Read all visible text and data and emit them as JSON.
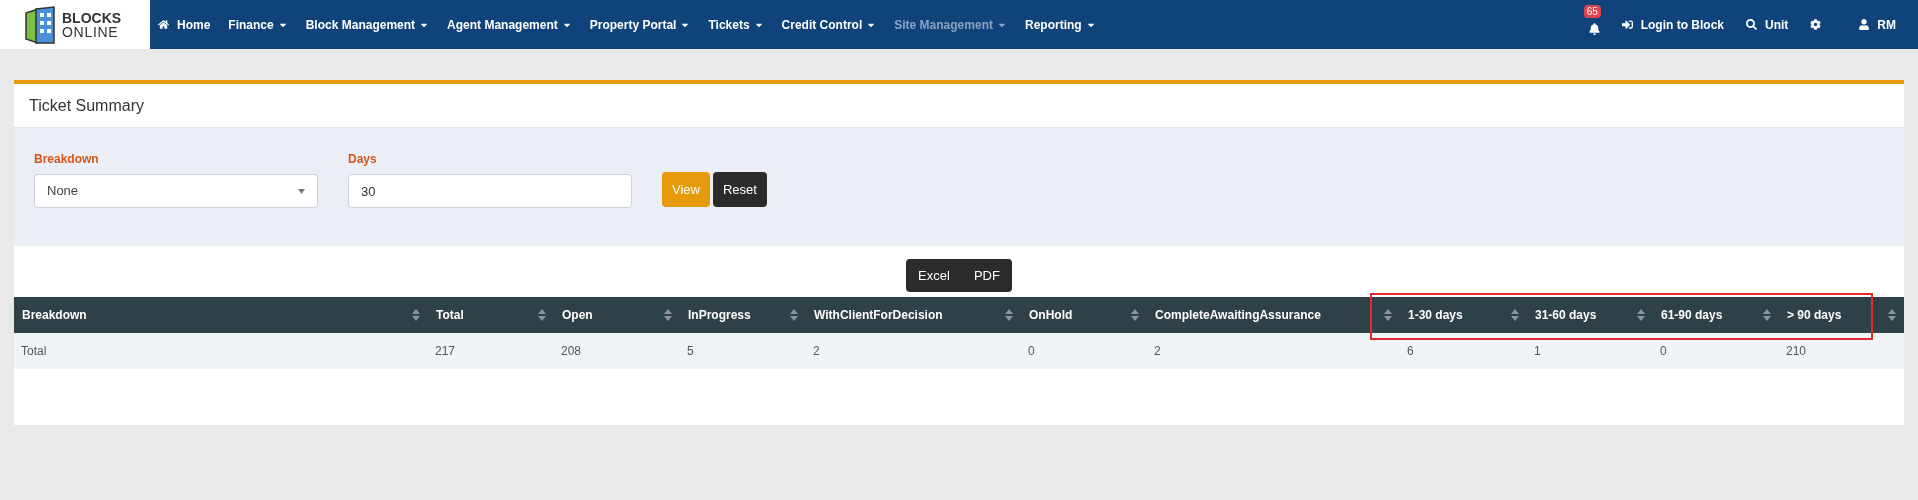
{
  "logo": {
    "line1": "BLOCKS",
    "line2": "ONLINE"
  },
  "nav": [
    {
      "label": "Home",
      "kind": "home",
      "dropdown": false,
      "disabled": false
    },
    {
      "label": "Finance",
      "dropdown": true,
      "disabled": false
    },
    {
      "label": "Block Management",
      "dropdown": true,
      "disabled": false
    },
    {
      "label": "Agent Management",
      "dropdown": true,
      "disabled": false
    },
    {
      "label": "Property Portal",
      "dropdown": true,
      "disabled": false
    },
    {
      "label": "Tickets",
      "dropdown": true,
      "disabled": false
    },
    {
      "label": "Credit Control",
      "dropdown": true,
      "disabled": false
    },
    {
      "label": "Site Management",
      "dropdown": true,
      "disabled": true
    },
    {
      "label": "Reporting",
      "dropdown": true,
      "disabled": false
    }
  ],
  "nav_right": {
    "notifications": {
      "count": "65"
    },
    "login": "Login to Block",
    "search": "Unit",
    "user": "RM"
  },
  "panel": {
    "title": "Ticket Summary"
  },
  "filters": {
    "breakdown": {
      "label": "Breakdown",
      "value": "None"
    },
    "days": {
      "label": "Days",
      "value": "30"
    },
    "buttons": [
      {
        "label": "View",
        "kind": "primary"
      },
      {
        "label": "Reset",
        "kind": "dark"
      }
    ]
  },
  "export_buttons": [
    "Excel",
    "PDF"
  ],
  "table": {
    "columns": [
      "Breakdown",
      "Total",
      "Open",
      "InProgress",
      "WithClientForDecision",
      "OnHold",
      "CompleteAwaitingAssurance",
      "1-30 days",
      "31-60 days",
      "61-90 days",
      "> 90 days"
    ],
    "rows": [
      [
        "Total",
        "217",
        "208",
        "5",
        "2",
        "0",
        "2",
        "6",
        "1",
        "0",
        "210"
      ]
    ]
  }
}
